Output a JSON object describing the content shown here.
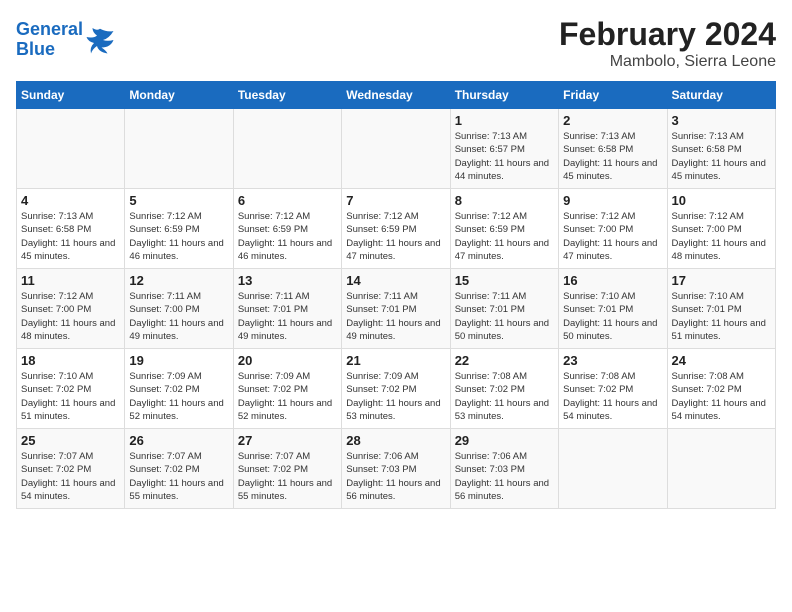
{
  "header": {
    "logo_line1": "General",
    "logo_line2": "Blue",
    "title": "February 2024",
    "subtitle": "Mambolo, Sierra Leone"
  },
  "days_of_week": [
    "Sunday",
    "Monday",
    "Tuesday",
    "Wednesday",
    "Thursday",
    "Friday",
    "Saturday"
  ],
  "weeks": [
    [
      {
        "day": "",
        "info": ""
      },
      {
        "day": "",
        "info": ""
      },
      {
        "day": "",
        "info": ""
      },
      {
        "day": "",
        "info": ""
      },
      {
        "day": "1",
        "info": "Sunrise: 7:13 AM\nSunset: 6:57 PM\nDaylight: 11 hours and 44 minutes."
      },
      {
        "day": "2",
        "info": "Sunrise: 7:13 AM\nSunset: 6:58 PM\nDaylight: 11 hours and 45 minutes."
      },
      {
        "day": "3",
        "info": "Sunrise: 7:13 AM\nSunset: 6:58 PM\nDaylight: 11 hours and 45 minutes."
      }
    ],
    [
      {
        "day": "4",
        "info": "Sunrise: 7:13 AM\nSunset: 6:58 PM\nDaylight: 11 hours and 45 minutes."
      },
      {
        "day": "5",
        "info": "Sunrise: 7:12 AM\nSunset: 6:59 PM\nDaylight: 11 hours and 46 minutes."
      },
      {
        "day": "6",
        "info": "Sunrise: 7:12 AM\nSunset: 6:59 PM\nDaylight: 11 hours and 46 minutes."
      },
      {
        "day": "7",
        "info": "Sunrise: 7:12 AM\nSunset: 6:59 PM\nDaylight: 11 hours and 47 minutes."
      },
      {
        "day": "8",
        "info": "Sunrise: 7:12 AM\nSunset: 6:59 PM\nDaylight: 11 hours and 47 minutes."
      },
      {
        "day": "9",
        "info": "Sunrise: 7:12 AM\nSunset: 7:00 PM\nDaylight: 11 hours and 47 minutes."
      },
      {
        "day": "10",
        "info": "Sunrise: 7:12 AM\nSunset: 7:00 PM\nDaylight: 11 hours and 48 minutes."
      }
    ],
    [
      {
        "day": "11",
        "info": "Sunrise: 7:12 AM\nSunset: 7:00 PM\nDaylight: 11 hours and 48 minutes."
      },
      {
        "day": "12",
        "info": "Sunrise: 7:11 AM\nSunset: 7:00 PM\nDaylight: 11 hours and 49 minutes."
      },
      {
        "day": "13",
        "info": "Sunrise: 7:11 AM\nSunset: 7:01 PM\nDaylight: 11 hours and 49 minutes."
      },
      {
        "day": "14",
        "info": "Sunrise: 7:11 AM\nSunset: 7:01 PM\nDaylight: 11 hours and 49 minutes."
      },
      {
        "day": "15",
        "info": "Sunrise: 7:11 AM\nSunset: 7:01 PM\nDaylight: 11 hours and 50 minutes."
      },
      {
        "day": "16",
        "info": "Sunrise: 7:10 AM\nSunset: 7:01 PM\nDaylight: 11 hours and 50 minutes."
      },
      {
        "day": "17",
        "info": "Sunrise: 7:10 AM\nSunset: 7:01 PM\nDaylight: 11 hours and 51 minutes."
      }
    ],
    [
      {
        "day": "18",
        "info": "Sunrise: 7:10 AM\nSunset: 7:02 PM\nDaylight: 11 hours and 51 minutes."
      },
      {
        "day": "19",
        "info": "Sunrise: 7:09 AM\nSunset: 7:02 PM\nDaylight: 11 hours and 52 minutes."
      },
      {
        "day": "20",
        "info": "Sunrise: 7:09 AM\nSunset: 7:02 PM\nDaylight: 11 hours and 52 minutes."
      },
      {
        "day": "21",
        "info": "Sunrise: 7:09 AM\nSunset: 7:02 PM\nDaylight: 11 hours and 53 minutes."
      },
      {
        "day": "22",
        "info": "Sunrise: 7:08 AM\nSunset: 7:02 PM\nDaylight: 11 hours and 53 minutes."
      },
      {
        "day": "23",
        "info": "Sunrise: 7:08 AM\nSunset: 7:02 PM\nDaylight: 11 hours and 54 minutes."
      },
      {
        "day": "24",
        "info": "Sunrise: 7:08 AM\nSunset: 7:02 PM\nDaylight: 11 hours and 54 minutes."
      }
    ],
    [
      {
        "day": "25",
        "info": "Sunrise: 7:07 AM\nSunset: 7:02 PM\nDaylight: 11 hours and 54 minutes."
      },
      {
        "day": "26",
        "info": "Sunrise: 7:07 AM\nSunset: 7:02 PM\nDaylight: 11 hours and 55 minutes."
      },
      {
        "day": "27",
        "info": "Sunrise: 7:07 AM\nSunset: 7:02 PM\nDaylight: 11 hours and 55 minutes."
      },
      {
        "day": "28",
        "info": "Sunrise: 7:06 AM\nSunset: 7:03 PM\nDaylight: 11 hours and 56 minutes."
      },
      {
        "day": "29",
        "info": "Sunrise: 7:06 AM\nSunset: 7:03 PM\nDaylight: 11 hours and 56 minutes."
      },
      {
        "day": "",
        "info": ""
      },
      {
        "day": "",
        "info": ""
      }
    ]
  ]
}
